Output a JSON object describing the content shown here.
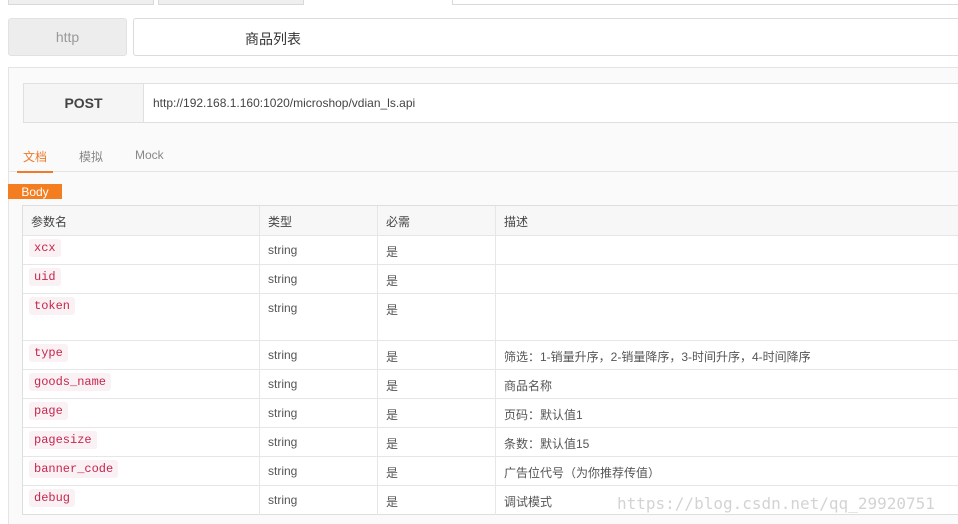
{
  "request": {
    "protocol": "http",
    "name": "商品列表",
    "method": "POST",
    "url": "http://192.168.1.160:1020/microshop/vdian_ls.api"
  },
  "tabs": [
    {
      "label": "文档"
    },
    {
      "label": "模拟"
    },
    {
      "label": "Mock"
    }
  ],
  "section_badge": "Body",
  "table": {
    "headers": [
      "参数名",
      "类型",
      "必需",
      "描述"
    ],
    "rows": [
      {
        "name": "xcx",
        "type": "string",
        "required": "是",
        "desc": ""
      },
      {
        "name": "uid",
        "type": "string",
        "required": "是",
        "desc": ""
      },
      {
        "name": "token",
        "type": "string",
        "required": "是",
        "desc": ""
      },
      {
        "name": "type",
        "type": "string",
        "required": "是",
        "desc": "筛选：1-销量升序，2-销量降序，3-时间升序，4-时间降序"
      },
      {
        "name": "goods_name",
        "type": "string",
        "required": "是",
        "desc": "商品名称"
      },
      {
        "name": "page",
        "type": "string",
        "required": "是",
        "desc": "页码：默认值1"
      },
      {
        "name": "pagesize",
        "type": "string",
        "required": "是",
        "desc": "条数：默认值15"
      },
      {
        "name": "banner_code",
        "type": "string",
        "required": "是",
        "desc": "广告位代号（为你推荐传值）"
      },
      {
        "name": "debug",
        "type": "string",
        "required": "是",
        "desc": "调试模式"
      }
    ]
  },
  "watermark": "https://blog.csdn.net/qq_29920751"
}
